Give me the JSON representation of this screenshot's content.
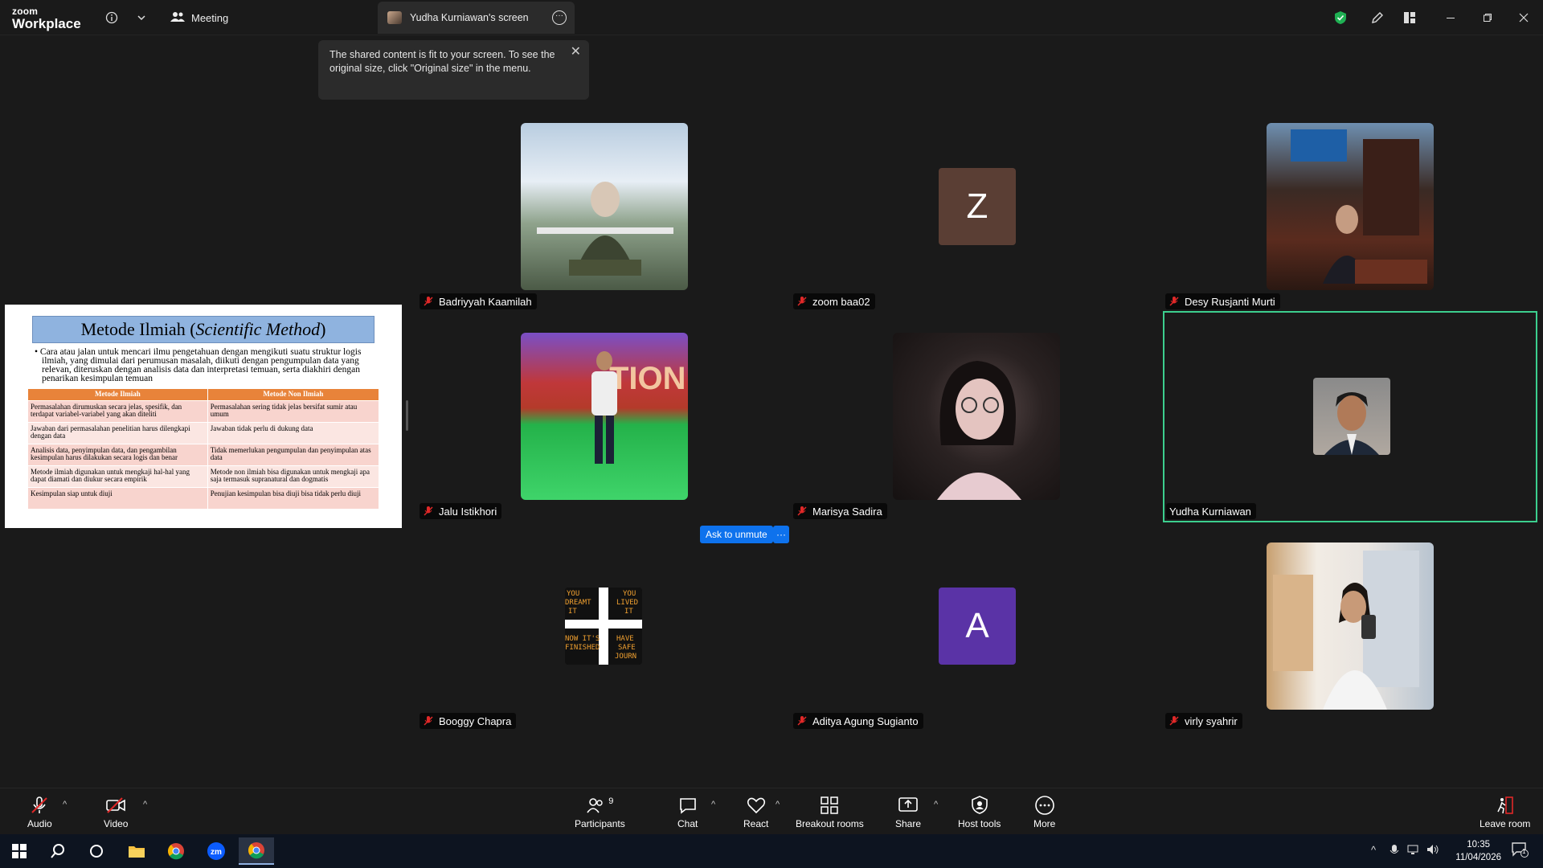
{
  "titlebar": {
    "brand_top": "zoom",
    "brand_bottom": "Workplace",
    "meeting_label": "Meeting",
    "screen_tab_label": "Yudha Kurniawan's screen"
  },
  "tooltip": {
    "text": "The shared content is fit to your screen. To see the original size, click \"Original size\" in the menu."
  },
  "slide": {
    "title_main": "Metode Ilmiah (",
    "title_italic": "Scientific Method",
    "title_end": ")",
    "bullet": "• Cara atau jalan untuk mencari ilmu pengetahuan dengan mengikuti suatu struktur logis ilmiah, yang dimulai dari perumusan masalah, diikuti dengan pengumpulan data yang relevan, diteruskan dengan analisis data dan interpretasi temuan, serta diakhiri dengan penarikan kesimpulan temuan",
    "headers": [
      "Metode Ilmiah",
      "Metode Non Ilmiah"
    ],
    "rows": [
      [
        "Permasalahan dirumuskan secara jelas, spesifik, dan terdapat variabel-variabel yang akan diteliti",
        "Permasalahan sering tidak jelas bersifat sumir atau umum"
      ],
      [
        "Jawaban dari permasalahan penelitian harus dilengkapi dengan data",
        "Jawaban tidak perlu di dukung data"
      ],
      [
        "Analisis data, penyimpulan data, dan pengambilan kesimpulan harus dilakukan secara logis dan benar",
        "Tidak memerlukan pengumpulan dan penyimpulan atas data"
      ],
      [
        "Metode ilmiah digunakan untuk mengkaji hal-hal yang dapat diamati dan diukur secara empirik",
        "Metode non ilmiah bisa digunakan untuk mengkaji apa saja termasuk supranatural dan dogmatis"
      ],
      [
        "Kesimpulan siap untuk diuji",
        "Penujian kesimpulan bisa diuji bisa tidak perlu diuji"
      ]
    ]
  },
  "participants": [
    {
      "name": "Badriyyah Kaamilah",
      "type": "photo"
    },
    {
      "name": "zoom baa02",
      "type": "avatar",
      "letter": "Z",
      "color": "#5a3e34"
    },
    {
      "name": "Desy Rusjanti Murti",
      "type": "photo"
    },
    {
      "name": "Jalu Istikhori",
      "type": "photo"
    },
    {
      "name": "Marisya Sadira",
      "type": "photo"
    },
    {
      "name": "Yudha Kurniawan",
      "type": "photo",
      "active": true
    },
    {
      "name": "Booggy Chapra",
      "type": "photo"
    },
    {
      "name": "Aditya Agung Sugianto",
      "type": "avatar",
      "letter": "A",
      "color": "#5a33a6"
    },
    {
      "name": "virly syahrir",
      "type": "photo"
    }
  ],
  "booggy_text": [
    "YOU",
    "DREAMT",
    "IT",
    "YOU",
    "LIVED",
    "IT",
    "NOW IT'S",
    "FINISHED",
    "HAVE",
    "SAFE",
    "JOURN"
  ],
  "ask": {
    "unmute": "Ask to unmute",
    "more": "···"
  },
  "toolbar": {
    "audio": "Audio",
    "video": "Video",
    "participants": "Participants",
    "participants_count": "9",
    "chat": "Chat",
    "react": "React",
    "breakout": "Breakout rooms",
    "share": "Share",
    "host_tools": "Host tools",
    "more": "More",
    "leave": "Leave room"
  },
  "taskbar": {
    "time": "10:35",
    "date": "11/04/2026",
    "notif_count": "1"
  },
  "colors": {
    "active_speaker": "#3ccf8e",
    "accent_blue": "#0e72ed",
    "muted_red": "#e02828"
  }
}
